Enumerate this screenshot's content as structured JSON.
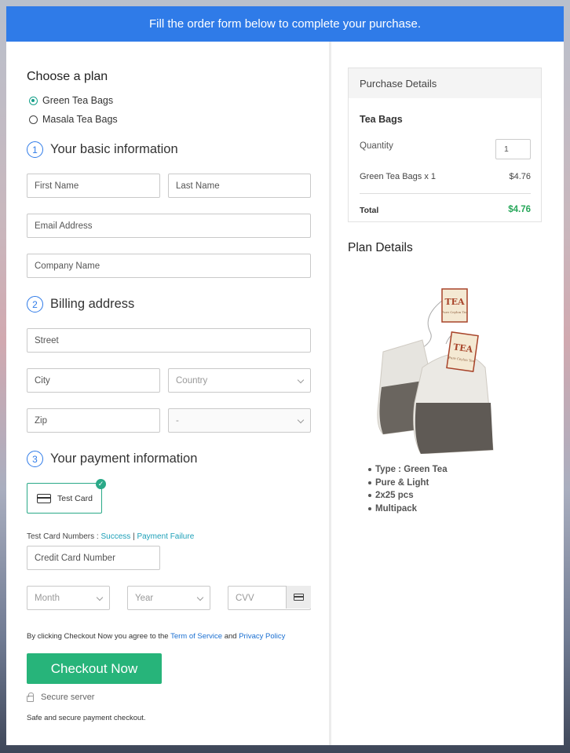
{
  "banner": {
    "text": "Fill the order form below to complete your purchase."
  },
  "plan": {
    "heading": "Choose a plan",
    "options": [
      {
        "label": "Green Tea Bags",
        "selected": true
      },
      {
        "label": "Masala Tea Bags",
        "selected": false
      }
    ]
  },
  "basic_info": {
    "number": "1",
    "title": "Your basic information",
    "first_name_placeholder": "First Name",
    "last_name_placeholder": "Last Name",
    "email_placeholder": "Email Address",
    "company_placeholder": "Company Name"
  },
  "billing": {
    "number": "2",
    "title": "Billing address",
    "street_placeholder": "Street",
    "city_placeholder": "City",
    "country_placeholder": "Country",
    "zip_placeholder": "Zip",
    "state_placeholder": "-"
  },
  "payment": {
    "number": "3",
    "title": "Your payment information",
    "method_label": "Test Card",
    "test_numbers_label": "Test Card Numbers : ",
    "success_link": "Success",
    "separator": "|",
    "failure_link": "Payment Failure",
    "card_number_placeholder": "Credit Card Number",
    "month_placeholder": "Month",
    "year_placeholder": "Year",
    "cvv_placeholder": "CVV"
  },
  "agreement": {
    "prefix": "By clicking Checkout Now you agree to the ",
    "terms_link": "Term of Service",
    "and": " and ",
    "privacy_link": "Privacy Policy"
  },
  "checkout_button": "Checkout Now",
  "secure_server": "Secure server",
  "safe_text": "Safe and secure payment checkout.",
  "purchase_details": {
    "heading": "Purchase Details",
    "product": "Tea Bags",
    "quantity_label": "Quantity",
    "quantity_value": "1",
    "line_item": "Green Tea Bags x 1",
    "line_price": "$4.76",
    "total_label": "Total",
    "total_value": "$4.76"
  },
  "plan_details": {
    "heading": "Plan Details",
    "tag_brand": "TEA",
    "tag_subtitle": "Pure Ceylon Tea",
    "features": [
      "Type : Green Tea",
      "Pure & Light",
      "2x25 pcs",
      "Multipack"
    ]
  },
  "colors": {
    "banner": "#2f7be8",
    "checkout": "#27b47a",
    "total": "#27a75a",
    "link": "#1ea0b8",
    "selected_radio": "#16a08a"
  }
}
